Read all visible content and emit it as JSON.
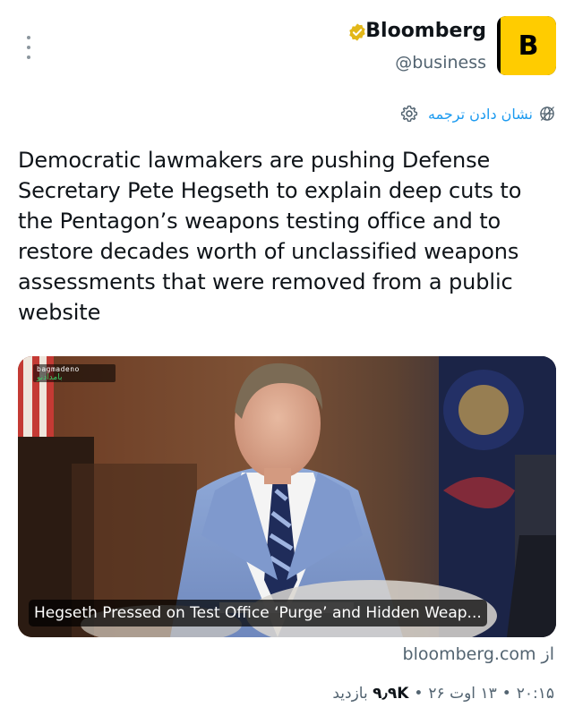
{
  "author": {
    "display_name": "Bloomberg",
    "handle": "@business",
    "avatar_letter": "B",
    "avatar_color": "#ffcc00",
    "verified_badge": "gold-verified-badge-icon"
  },
  "translate": {
    "label": "نشان دادن ترجمه",
    "icon": "globe-icon",
    "settings_icon": "gear-icon"
  },
  "tweet": {
    "text": "Democratic lawmakers are pushing Defense Secretary Pete Hegseth to explain deep cuts to the Pentagon’s weapons testing office and to restore decades worth of unclassified weapons assessments that were removed from a public website"
  },
  "card": {
    "headline": "Hegseth Pressed on Test Office ‘Purge’ and Hidden Weap...",
    "watermark_top": "bagmadeno",
    "watermark_bottom": "بامدادنو"
  },
  "source": {
    "from_label": "از",
    "domain": "bloomberg.com"
  },
  "meta": {
    "time": "۲۰:۱۵",
    "date": "۱۳ اوت ۲۶",
    "separator": "•",
    "views_count": "۹٫۹K",
    "views_label": "بازدید"
  },
  "colors": {
    "link": "#1d9bf0",
    "secondary_text": "#536471",
    "primary_text": "#0f1419"
  }
}
